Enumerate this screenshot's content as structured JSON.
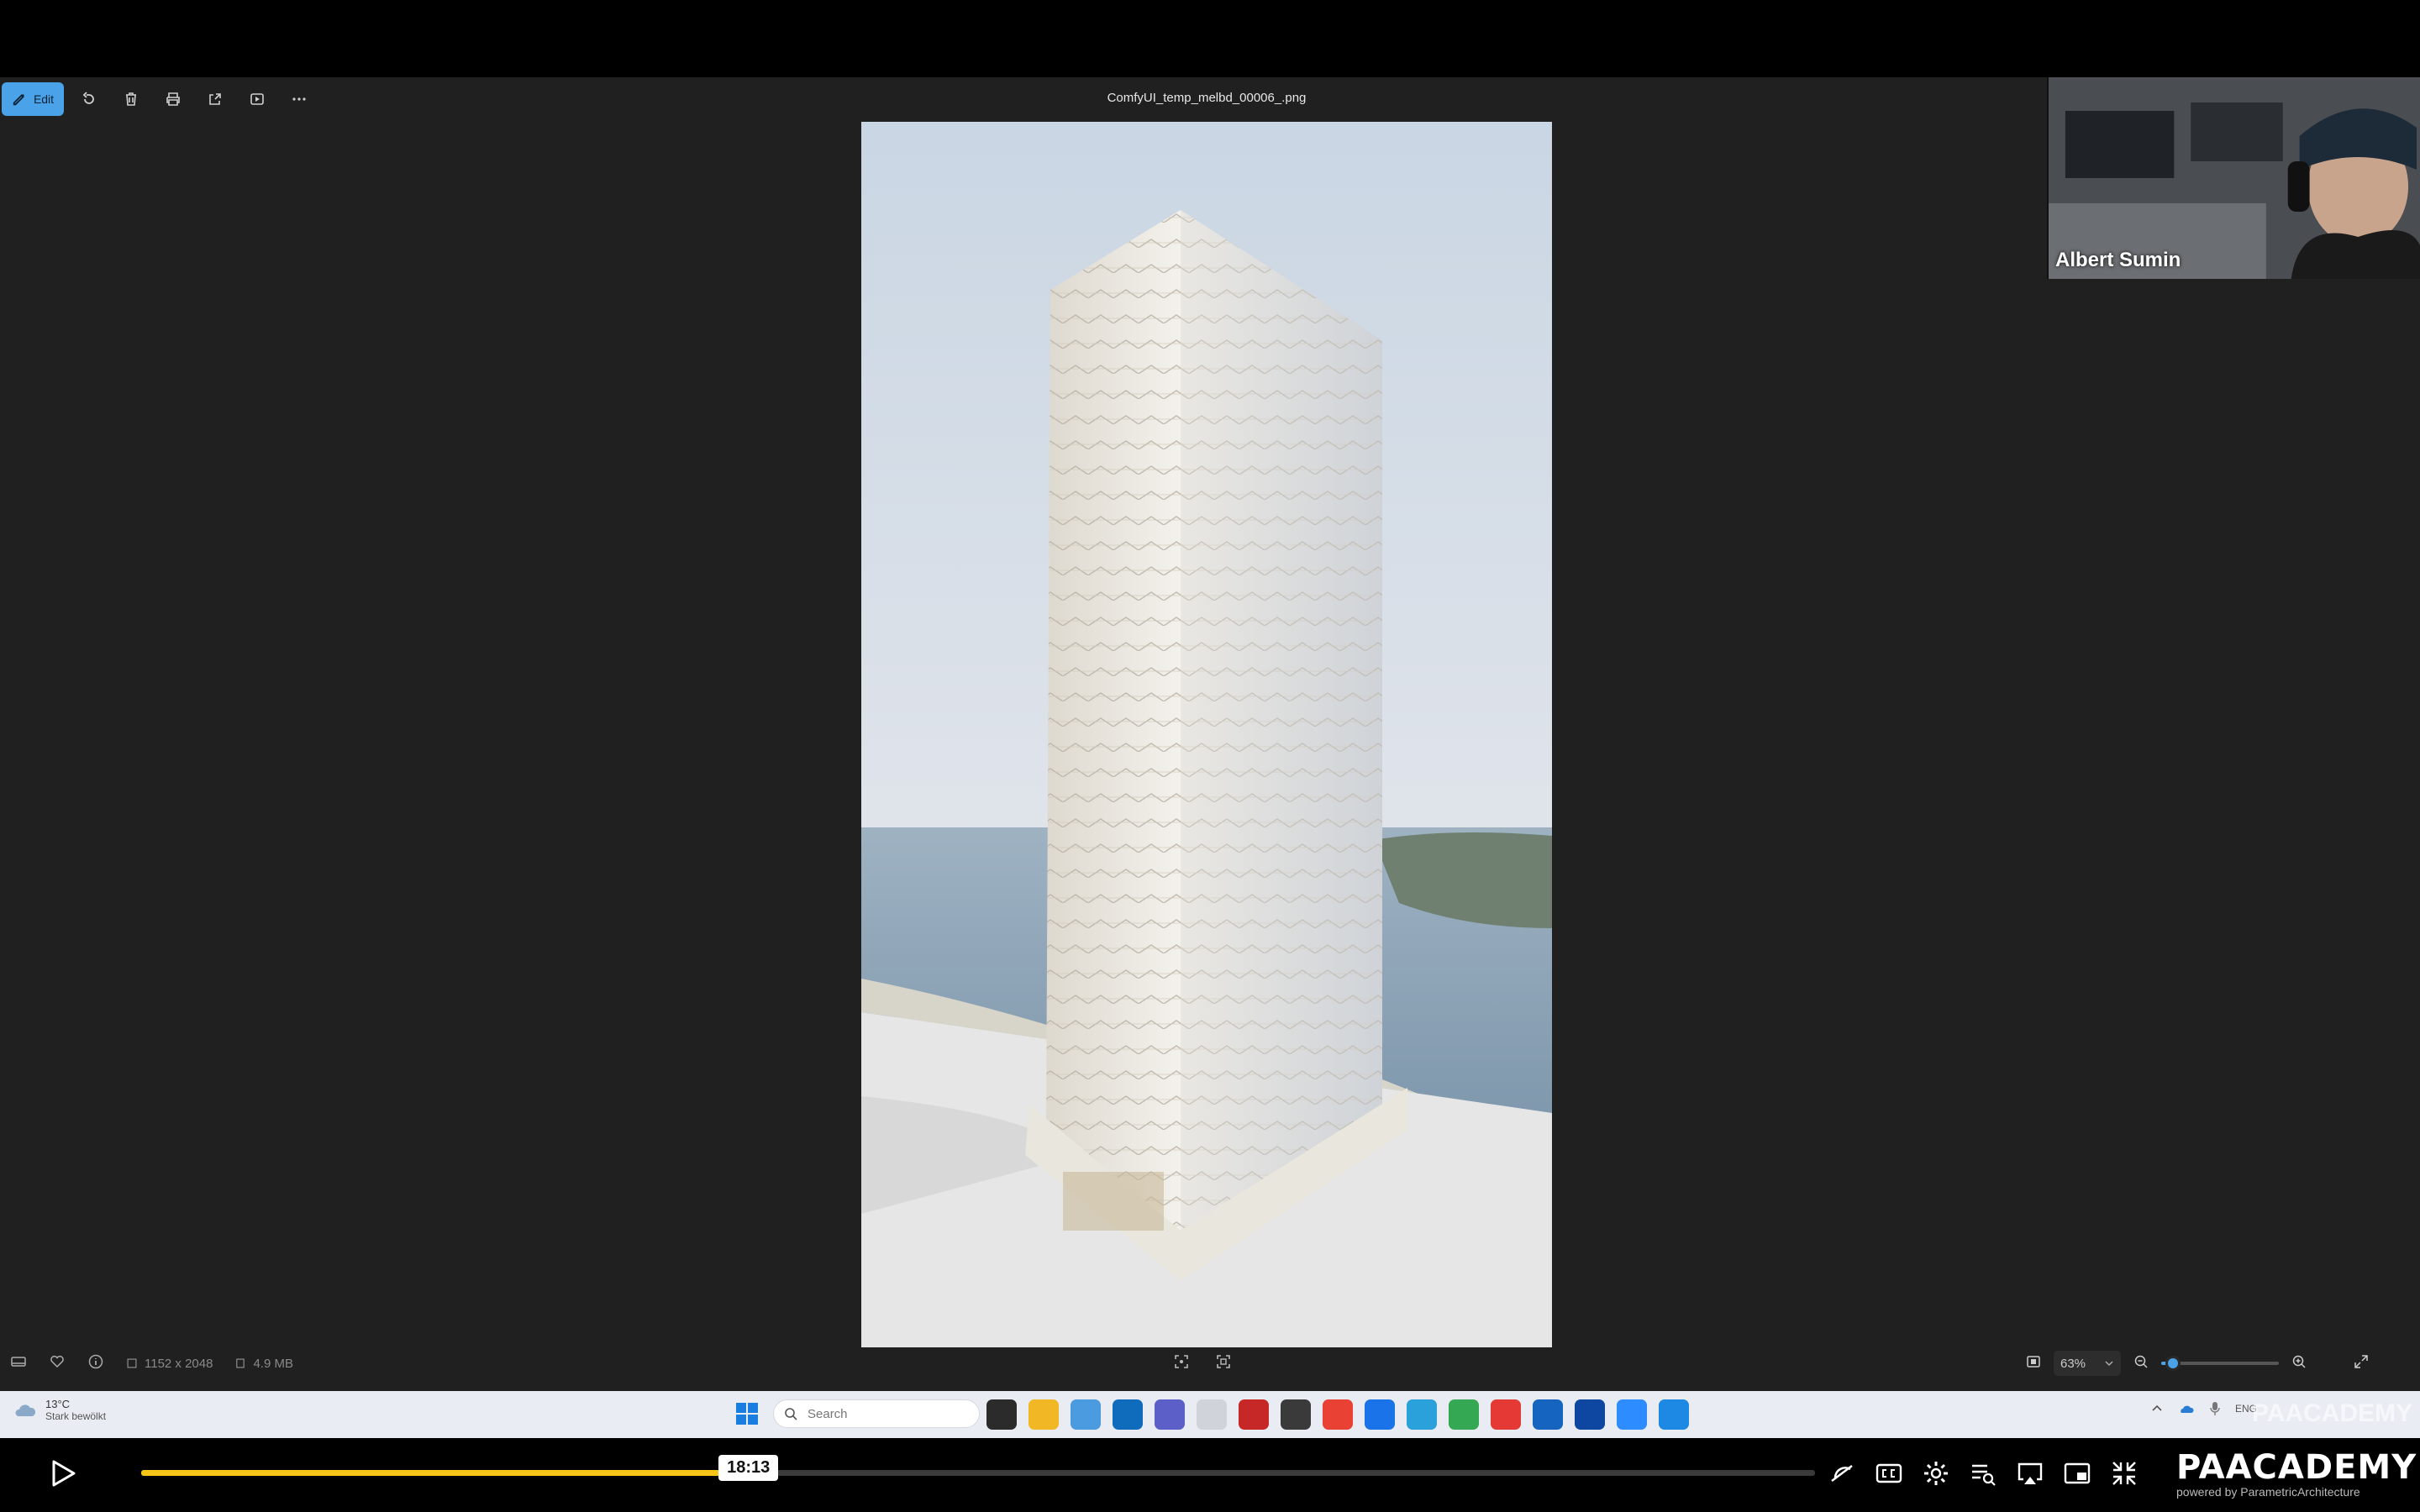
{
  "app": {
    "filename": "ComfyUI_temp_melbd_00006_.png",
    "toolbar": {
      "edit_label": "Edit",
      "buttons": [
        "rotate-icon",
        "delete-icon",
        "print-icon",
        "share-icon",
        "slideshow-icon",
        "more-icon"
      ]
    },
    "status": {
      "dimensions": "1152 x 2048",
      "filesize": "4.9 MB",
      "zoom_label": "63%",
      "zoom_fraction": 0.1
    }
  },
  "webcam": {
    "name": "Albert Sumin"
  },
  "taskbar": {
    "weather_temp": "13°C",
    "weather_condition": "Stark bewölkt",
    "search_placeholder": "Search",
    "lang": "ENG"
  },
  "player": {
    "time_tooltip": "18:13",
    "progress_fraction": 0.361,
    "brand_name": "PAACADEMY",
    "brand_sub": "powered by ParametricArchitecture",
    "watermark": "PAACADEMY"
  },
  "colors": {
    "accent": "#4aa3e8",
    "progress": "#f5c518",
    "viewer_bg": "#202020"
  }
}
